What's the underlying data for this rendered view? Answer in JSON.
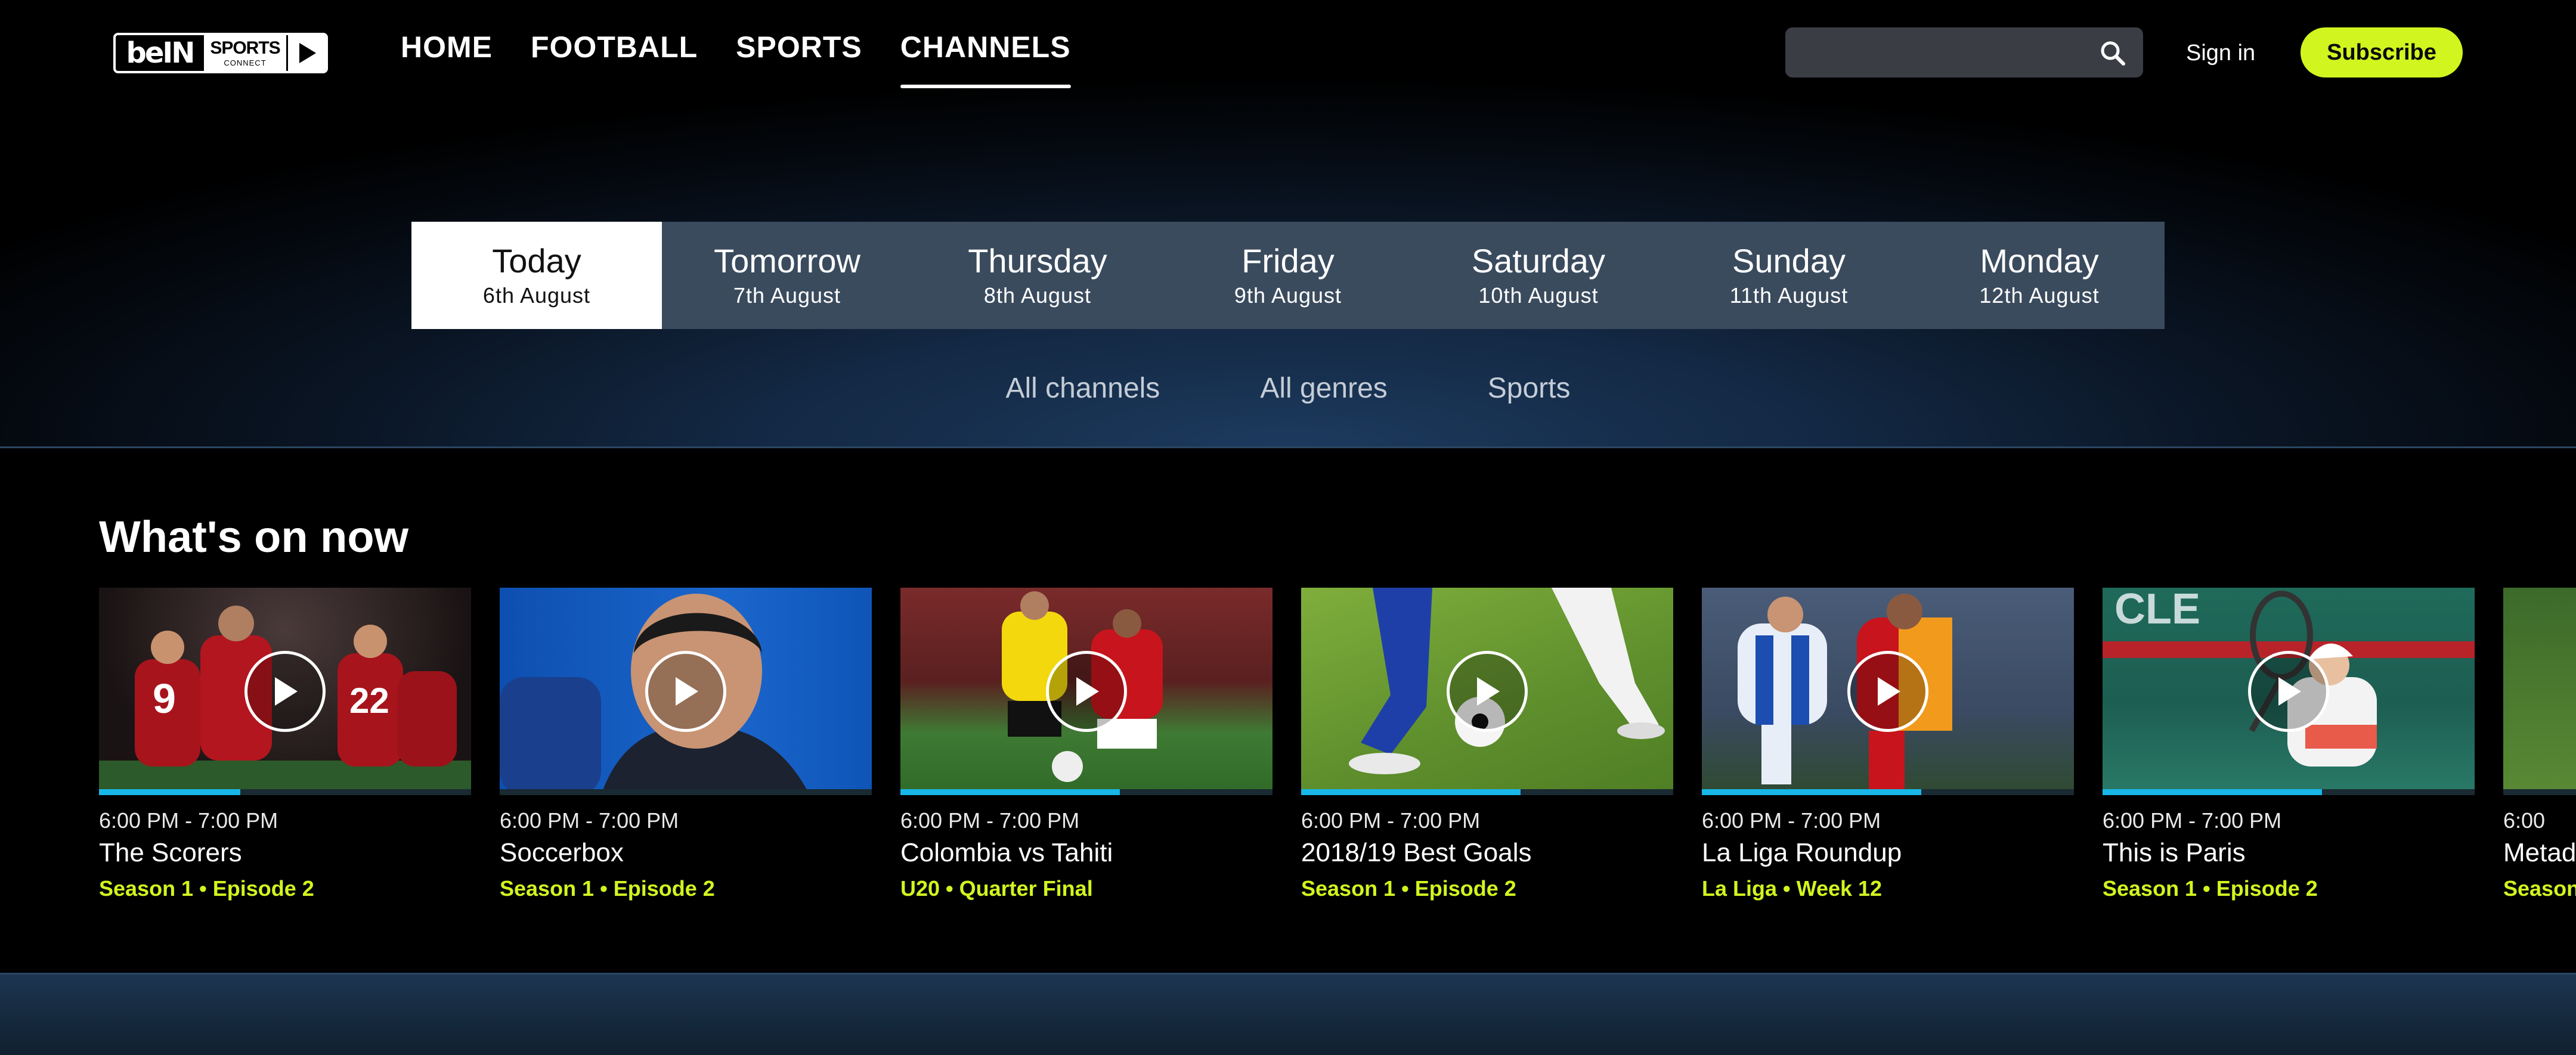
{
  "brand": {
    "logo_text_left": "beIN",
    "logo_text_sports": "SPORTS",
    "logo_text_connect": "CONNECT"
  },
  "nav": {
    "items": [
      {
        "label": "HOME",
        "active": false
      },
      {
        "label": "FOOTBALL",
        "active": false
      },
      {
        "label": "SPORTS",
        "active": false
      },
      {
        "label": "CHANNELS",
        "active": true
      }
    ]
  },
  "header": {
    "search_value": "",
    "search_placeholder": "",
    "signin_label": "Sign in",
    "subscribe_label": "Subscribe"
  },
  "dates": [
    {
      "day": "Today",
      "date": "6th August",
      "active": true
    },
    {
      "day": "Tomorrow",
      "date": "7th August",
      "active": false
    },
    {
      "day": "Thursday",
      "date": "8th August",
      "active": false
    },
    {
      "day": "Friday",
      "date": "9th August",
      "active": false
    },
    {
      "day": "Saturday",
      "date": "10th August",
      "active": false
    },
    {
      "day": "Sunday",
      "date": "11th August",
      "active": false
    },
    {
      "day": "Monday",
      "date": "12th August",
      "active": false
    }
  ],
  "filters": [
    "All channels",
    "All genres",
    "Sports"
  ],
  "section": {
    "title": "What's on now"
  },
  "cards": [
    {
      "time": "6:00 PM - 7:00 PM",
      "title": "The Scorers",
      "meta": "Season 1 • Episode 2",
      "progress": 0.38
    },
    {
      "time": "6:00 PM - 7:00 PM",
      "title": "Soccerbox",
      "meta": "Season 1 • Episode 2",
      "progress": 0.0
    },
    {
      "time": "6:00 PM - 7:00 PM",
      "title": "Colombia vs Tahiti",
      "meta": "U20 • Quarter Final",
      "progress": 0.59
    },
    {
      "time": "6:00 PM - 7:00 PM",
      "title": "2018/19 Best Goals",
      "meta": "Season 1 • Episode 2",
      "progress": 0.59
    },
    {
      "time": "6:00 PM - 7:00 PM",
      "title": "La Liga Roundup",
      "meta": "La Liga • Week 12",
      "progress": 0.59
    },
    {
      "time": "6:00 PM - 7:00 PM",
      "title": "This is Paris",
      "meta": "Season 1 • Episode 2",
      "progress": 0.59
    },
    {
      "time": "6:00",
      "title": "Metad",
      "meta": "Season",
      "progress": 0.0
    }
  ],
  "colors": {
    "accent": "#d1f51f",
    "progress": "#18b7e8",
    "date_bar": "#3b4b5e"
  }
}
